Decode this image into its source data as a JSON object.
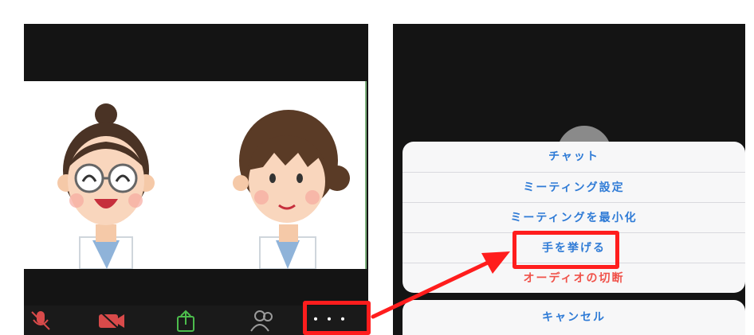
{
  "left_panel": {
    "toolbar": {
      "more_label": "・・・"
    },
    "participants": [
      {
        "role": "participant-laughing-glasses"
      },
      {
        "role": "participant-smiling"
      }
    ]
  },
  "right_panel": {
    "menu": {
      "items": [
        {
          "label": "チャット",
          "style": "normal"
        },
        {
          "label": "ミーティング設定",
          "style": "normal"
        },
        {
          "label": "ミーティングを最小化",
          "style": "normal"
        },
        {
          "label": "手を挙げる",
          "style": "normal"
        },
        {
          "label": "オーディオの切断",
          "style": "danger"
        }
      ],
      "cancel_label": "キャンセル"
    }
  },
  "colors": {
    "accent_blue": "#2f7bd6",
    "danger_red": "#f0524a",
    "annotation_red": "#ff1d1d",
    "panel_dark": "#141414"
  },
  "icons": [
    "microphone-muted-icon",
    "video-off-icon",
    "share-screen-icon",
    "participants-icon",
    "more-icon"
  ]
}
